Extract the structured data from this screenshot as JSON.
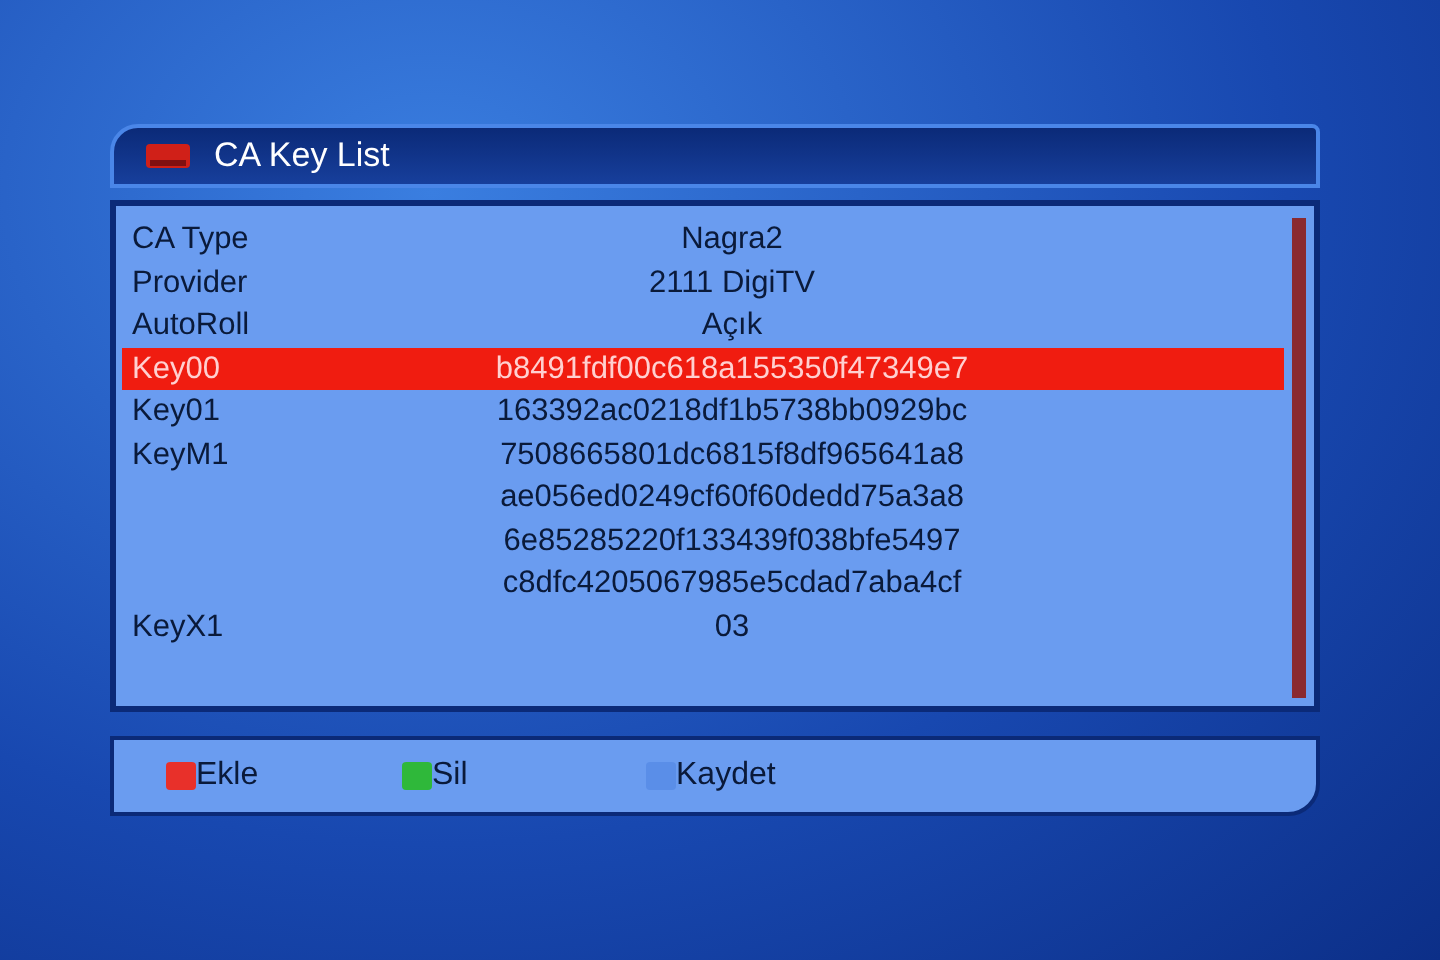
{
  "window": {
    "title": "CA Key List"
  },
  "rows": [
    {
      "label": "CA Type",
      "values": [
        "Nagra2"
      ],
      "selected": false
    },
    {
      "label": "Provider",
      "values": [
        "2111 DigiTV"
      ],
      "selected": false
    },
    {
      "label": "AutoRoll",
      "values": [
        "Açık"
      ],
      "selected": false
    },
    {
      "label": "Key00",
      "values": [
        "b8491fdf00c618a155350f47349e7"
      ],
      "selected": true
    },
    {
      "label": "Key01",
      "values": [
        "163392ac0218df1b5738bb0929bc"
      ],
      "selected": false
    },
    {
      "label": "KeyM1",
      "values": [
        "7508665801dc6815f8df965641a8",
        "ae056ed0249cf60f60dedd75a3a8",
        "6e85285220f133439f038bfe5497",
        "c8dfc4205067985e5cdad7aba4cf"
      ],
      "selected": false
    },
    {
      "label": "KeyX1",
      "values": [
        "03"
      ],
      "selected": false
    }
  ],
  "footer": [
    {
      "label": "Ekle",
      "color": "#e8302a"
    },
    {
      "label": "Sil",
      "color": "#2fb83a"
    },
    {
      "label": "Kaydet",
      "color": "#5a8ee8"
    }
  ]
}
